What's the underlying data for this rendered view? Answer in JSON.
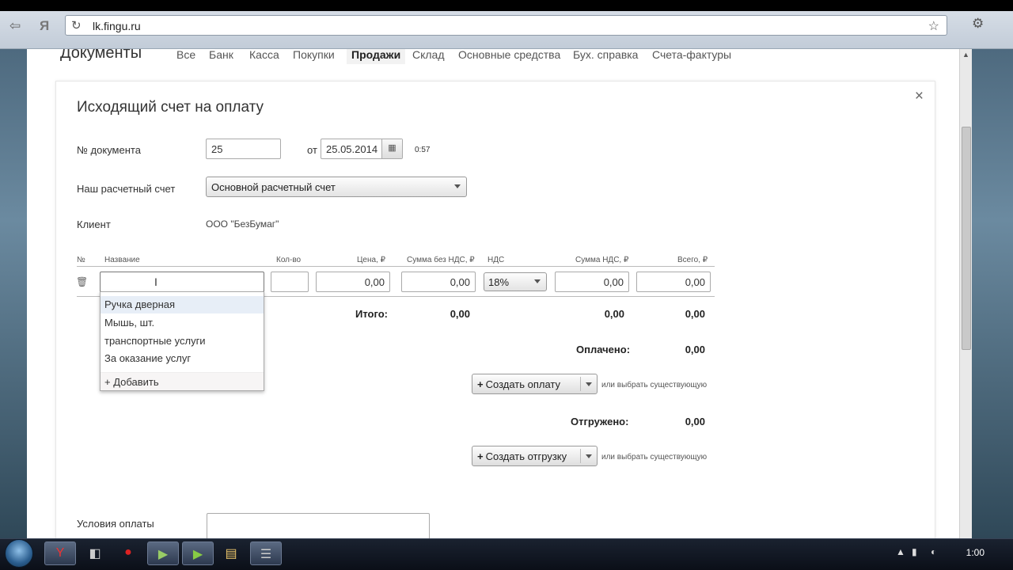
{
  "browser": {
    "url": "lk.fingu.ru",
    "back_icon": "back-arrow-icon",
    "forward_icon": "forward-arrow-icon",
    "yandex_icon": "yandex-icon"
  },
  "top_nav": {
    "title": "Документы",
    "items": [
      "Все",
      "Банк",
      "Касса",
      "Покупки",
      "Продажи",
      "Склад",
      "Основные средства",
      "Бух. справка",
      "Счета-фактуры"
    ],
    "active": "Продажи"
  },
  "modal": {
    "title": "Исходящий счет на оплату",
    "close": "×",
    "doc_number_label": "№ документа",
    "doc_number_value": "25",
    "date_from_label": "от",
    "date_value": "25.05.2014",
    "time_value": "0:57",
    "account_label": "Наш расчетный счет",
    "account_value": "Основной расчетный счет",
    "client_label": "Клиент",
    "client_value": "ООО \"БезБумаг\"",
    "table": {
      "headers": [
        "№",
        "Название",
        "Кол-во",
        "Цена, ₽",
        "Сумма без НДС, ₽",
        "НДС",
        "Сумма НДС, ₽",
        "Всего, ₽"
      ],
      "row": {
        "name": "",
        "qty": "",
        "price": "0,00",
        "sum_no_vat": "0,00",
        "vat": "18%",
        "vat_sum": "0,00",
        "total": "0,00"
      }
    },
    "totals": {
      "itogo_label": "Итого:",
      "itogo_sum_no_vat": "0,00",
      "itogo_vat_sum": "0,00",
      "itogo_total": "0,00",
      "paid_label": "Оплачено:",
      "paid_value": "0,00",
      "shipped_label": "Отгружено:",
      "shipped_value": "0,00"
    },
    "create_payment_btn": "Создать оплату",
    "create_shipment_btn": "Создать отгрузку",
    "or_choose_existing": "или выбрать существующую",
    "terms_label": "Условия оплаты"
  },
  "autocomplete": {
    "items": [
      "Ручка дверная",
      "Мышь, шт.",
      "транспортные услуги",
      "За оказание услуг"
    ],
    "add_label": "+ Добавить"
  },
  "taskbar": {
    "clock": "1:00"
  }
}
